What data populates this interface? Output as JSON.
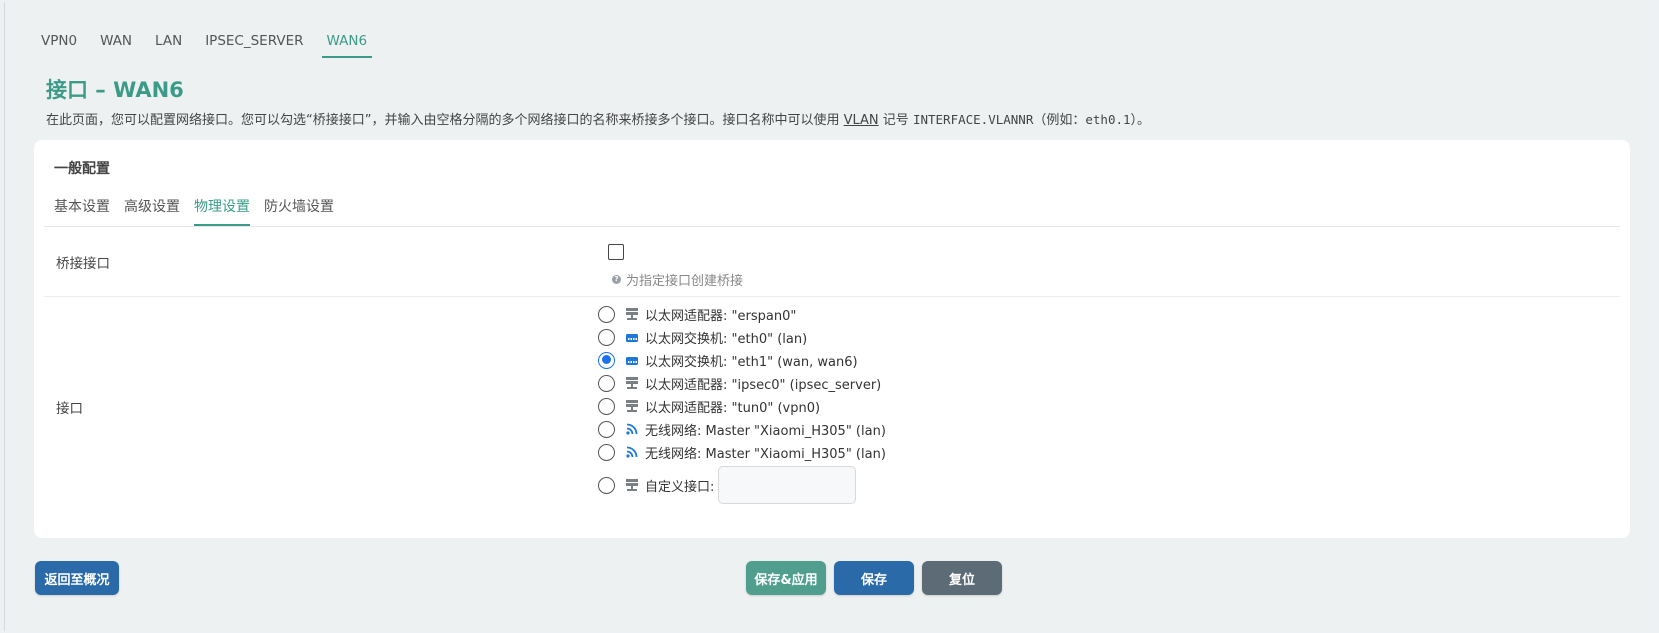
{
  "top_tabs": [
    {
      "label": "VPN0",
      "active": false
    },
    {
      "label": "WAN",
      "active": false
    },
    {
      "label": "LAN",
      "active": false
    },
    {
      "label": "IPSEC_SERVER",
      "active": false
    },
    {
      "label": "WAN6",
      "active": true
    }
  ],
  "page": {
    "title": "接口 – WAN6",
    "desc_part1": "在此页面，您可以配置网络接口。您可以勾选“桥接接口”，并输入由空格分隔的多个网络接口的名称来桥接多个接口。接口名称中可以使用 ",
    "desc_link": "VLAN",
    "desc_part2": " 记号 ",
    "desc_code1": "INTERFACE.VLANNR",
    "desc_part3": "（例如：",
    "desc_code2": "eth0.1",
    "desc_part4": "）。"
  },
  "panel": {
    "title": "一般配置",
    "tabs": [
      {
        "label": "基本设置",
        "active": false
      },
      {
        "label": "高级设置",
        "active": false
      },
      {
        "label": "物理设置",
        "active": true
      },
      {
        "label": "防火墙设置",
        "active": false
      }
    ]
  },
  "bridge": {
    "label": "桥接接口",
    "checked": false,
    "hint": "为指定接口创建桥接"
  },
  "interface": {
    "label": "接口",
    "options": [
      {
        "icon": "ethernet-adapter-icon",
        "text": "以太网适配器: \"erspan0\"",
        "checked": false
      },
      {
        "icon": "ethernet-switch-icon",
        "text": "以太网交换机: \"eth0\" (lan)",
        "checked": false
      },
      {
        "icon": "ethernet-switch-icon",
        "text": "以太网交换机: \"eth1\" (wan, wan6)",
        "checked": true
      },
      {
        "icon": "ethernet-adapter-icon",
        "text": "以太网适配器: \"ipsec0\" (ipsec_server)",
        "checked": false
      },
      {
        "icon": "ethernet-adapter-icon",
        "text": "以太网适配器: \"tun0\" (vpn0)",
        "checked": false
      },
      {
        "icon": "wifi-icon",
        "text": "无线网络: Master \"Xiaomi_H305\" (lan)",
        "checked": false
      },
      {
        "icon": "wifi-icon",
        "text": "无线网络: Master \"Xiaomi_H305\" (lan)",
        "checked": false
      }
    ],
    "custom": {
      "icon": "ethernet-adapter-icon",
      "label": "自定义接口:",
      "value": "",
      "checked": false
    }
  },
  "buttons": {
    "back": "返回至概况",
    "save_apply": "保存&应用",
    "save": "保存",
    "reset": "复位"
  },
  "colors": {
    "accent": "#3c9b88",
    "primary": "#2b6aa8",
    "radio_checked": "#1a73e8",
    "switch_icon": "#1e78d7"
  }
}
